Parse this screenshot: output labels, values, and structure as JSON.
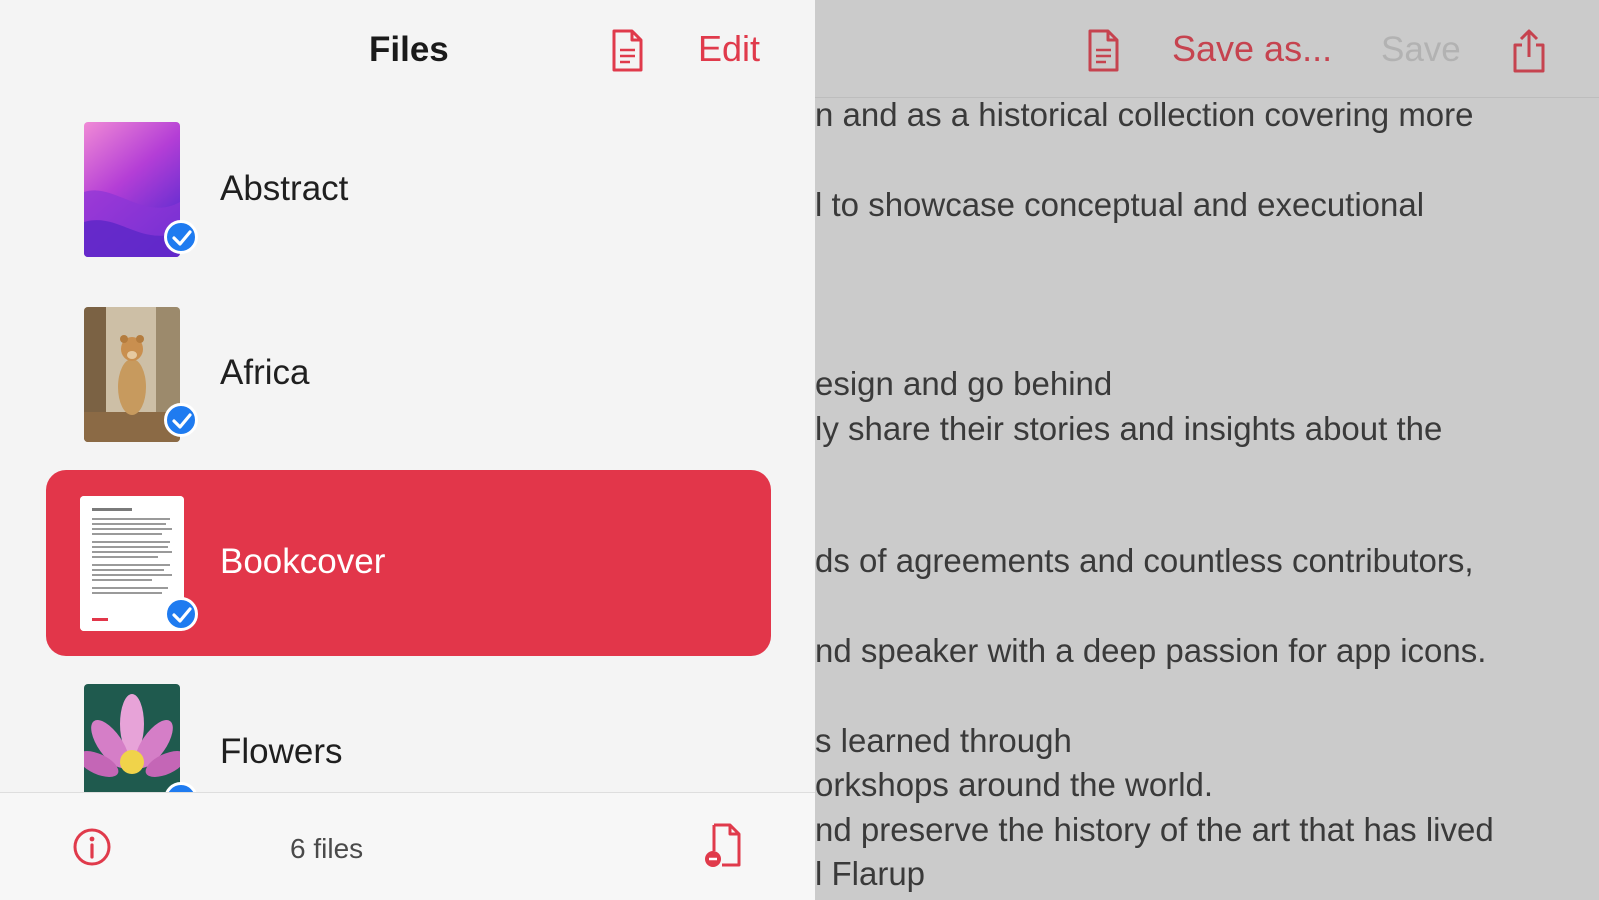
{
  "files_panel": {
    "title": "Files",
    "edit_label": "Edit",
    "new_document_icon": "new-document-icon",
    "files": [
      {
        "name": "Abstract",
        "thumbnail": "purple-abstract-wallpaper",
        "checked": true,
        "selected": false
      },
      {
        "name": "Africa",
        "thumbnail": "lioness-photo",
        "checked": true,
        "selected": false
      },
      {
        "name": "Bookcover",
        "thumbnail": "text-document-page",
        "checked": true,
        "selected": true
      },
      {
        "name": "Flowers",
        "thumbnail": "pink-lotus-flower",
        "checked": true,
        "selected": false
      }
    ],
    "footer": {
      "info_icon": "info-icon",
      "file_count": "6 files",
      "import_icon": "import-document-icon"
    }
  },
  "document_panel": {
    "document_icon": "document-icon",
    "save_as_label": "Save as...",
    "save_label": "Save",
    "share_icon": "share-icon",
    "lines": [
      "n and as a historical collection covering more",
      "l to showcase conceptual and executional",
      "esign and go behind",
      "ly share their stories and insights about the",
      "ds of agreements and countless contributors,",
      "nd speaker with a deep passion for app icons.",
      "s learned through",
      "orkshops around the world.",
      "nd preserve the history of the art that has lived",
      "l Flarup"
    ]
  },
  "colors": {
    "accent": "#e2364a",
    "checkmark_badge": "#1f7bf0",
    "sidebar_background": "#f4f4f4",
    "dimmed_document_background": "#cbcbcb"
  }
}
